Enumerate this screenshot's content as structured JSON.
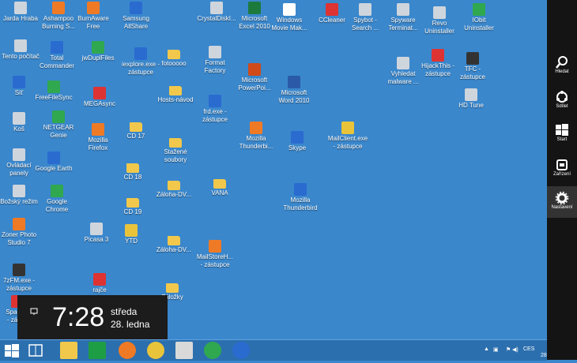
{
  "desktop_icons": [
    {
      "label": "Jarda Hraba"
    },
    {
      "label": "Ashampoo\nBurning S..."
    },
    {
      "label": "BurnAware\nFree"
    },
    {
      "label": "Samsung\nAllShare"
    },
    {
      "label": "CrystalDiskI..."
    },
    {
      "label": "Microsoft\nExcel 2010"
    },
    {
      "label": "Windows\nMovie Mak..."
    },
    {
      "label": "CCleaner"
    },
    {
      "label": "Spybot -\nSearch ..."
    },
    {
      "label": "Spyware\nTerminat..."
    },
    {
      "label": "Revo\nUninstaller"
    },
    {
      "label": "IObit\nUninstaller"
    },
    {
      "label": "Tento počítač"
    },
    {
      "label": "Total\nCommander"
    },
    {
      "label": "jwDuplFiles"
    },
    {
      "label": "iexplore.exe -\nzástupce"
    },
    {
      "label": "fotooooo"
    },
    {
      "label": "Format\nFactory"
    },
    {
      "label": "Vyhledat\nmalware ..."
    },
    {
      "label": "HijackThis -\nzástupce"
    },
    {
      "label": "TFC -\nzástupce"
    },
    {
      "label": "Síť"
    },
    {
      "label": "FreeFileSync"
    },
    {
      "label": "MEGAsync"
    },
    {
      "label": "Hosts-návod"
    },
    {
      "label": "Microsoft\nPowerPoi..."
    },
    {
      "label": "Microsoft\nWord 2010"
    },
    {
      "label": "HD Tune"
    },
    {
      "label": "Koš"
    },
    {
      "label": "NETGEAR\nGenie"
    },
    {
      "label": "Mozilla\nFirefox"
    },
    {
      "label": "CD 17"
    },
    {
      "label": "frd.exe -\nzástupce"
    },
    {
      "label": "Mozilla\nThunderbi..."
    },
    {
      "label": "Skype"
    },
    {
      "label": "MailClient.exe\n- zástupce"
    },
    {
      "label": "Ovládací\npanely"
    },
    {
      "label": "Google Earth"
    },
    {
      "label": "Stažené\nsoubory"
    },
    {
      "label": "CD 18"
    },
    {
      "label": "Božský režim"
    },
    {
      "label": "Google\nChrome"
    },
    {
      "label": "Záloha-DV..."
    },
    {
      "label": "VANA"
    },
    {
      "label": "Mozilla\nThunderbird"
    },
    {
      "label": "CD 19"
    },
    {
      "label": "Zoner Photo\nStudio 7"
    },
    {
      "label": "Picasa 3"
    },
    {
      "label": "YTD"
    },
    {
      "label": "Záloha-DV..."
    },
    {
      "label": "MailStoreH...\n- zástupce"
    },
    {
      "label": "7zFM.exe -\nzástupce"
    },
    {
      "label": "rajče"
    },
    {
      "label": "Záložky"
    },
    {
      "label": "Space...\n- zást..."
    }
  ],
  "charms": [
    {
      "label": "Hledat",
      "icon": "search-icon"
    },
    {
      "label": "Sdílet",
      "icon": "share-icon"
    },
    {
      "label": "Start",
      "icon": "windows-logo-icon"
    },
    {
      "label": "Zařízení",
      "icon": "devices-icon"
    },
    {
      "label": "Nastavení",
      "icon": "gear-icon"
    }
  ],
  "clock": {
    "time": "7:28",
    "day": "středa",
    "date": "28. ledna"
  },
  "tray": {
    "language": "CES",
    "date_fragment": "28"
  }
}
